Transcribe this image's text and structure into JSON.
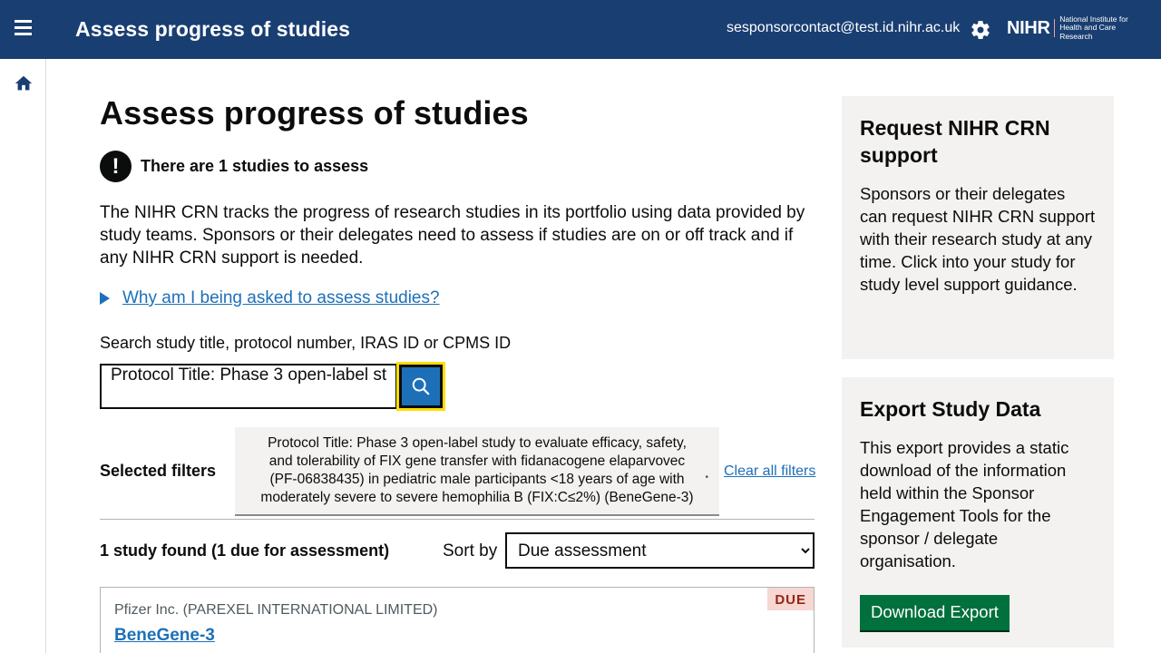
{
  "header": {
    "title": "Assess progress of studies",
    "user_email": "sesponsorcontact@test.id.nihr.ac.uk",
    "logo_main": "NIHR",
    "logo_sub": "National Institute for Health and Care Research",
    "menu_icon": "hamburger-icon",
    "settings_icon": "gear-icon"
  },
  "sidenav": {
    "home_icon": "home-icon"
  },
  "main": {
    "page_title": "Assess progress of studies",
    "warning": "There are 1 studies to assess",
    "warning_glyph": "!",
    "intro": "The NIHR CRN tracks the progress of research studies in its portfolio using data provided by study teams. Sponsors or their delegates need to assess if studies are on or off track and if any NIHR CRN support is needed.",
    "details_link": "Why am I being asked to assess studies?",
    "search": {
      "label": "Search study title, protocol number, IRAS ID or CPMS ID",
      "value": "Protocol Title: Phase 3 open-label st",
      "button_icon": "search-icon"
    },
    "filters": {
      "label": "Selected filters",
      "chip_text": "Protocol Title: Phase 3 open-label study to evaluate efficacy, safety, and tolerability of FIX gene transfer with fidanacogene elaparvovec (PF-06838435) in pediatric male participants <18 years of age with moderately severe to severe hemophilia B (FIX:C≤2%) (BeneGene-3)",
      "clear_link": "Clear all filters"
    },
    "results": {
      "count_text": "1 study found (1 due for assessment)",
      "sort_label": "Sort by",
      "sort_selected": "Due assessment"
    },
    "card": {
      "sponsor": "Pfizer Inc. (PAREXEL INTERNATIONAL LIMITED)",
      "title": "BeneGene-3",
      "badge": "DUE"
    }
  },
  "sidebar_panels": {
    "support": {
      "heading": "Request NIHR CRN support",
      "body": "Sponsors or their delegates can request NIHR CRN support with their research study at any time. Click into your study for study level support guidance."
    },
    "export": {
      "heading": "Export Study Data",
      "body": "This export provides a static download of the information held within the Sponsor Engagement Tools for the sponsor / delegate organisation.",
      "button": "Download Export"
    }
  },
  "colors": {
    "header_bg": "#193e72",
    "link": "#1d70b8",
    "focus": "#ffdd00",
    "button_green": "#00703c",
    "panel_bg": "#f3f2f1",
    "due_bg": "#f6d7d2",
    "due_text": "#942514"
  }
}
